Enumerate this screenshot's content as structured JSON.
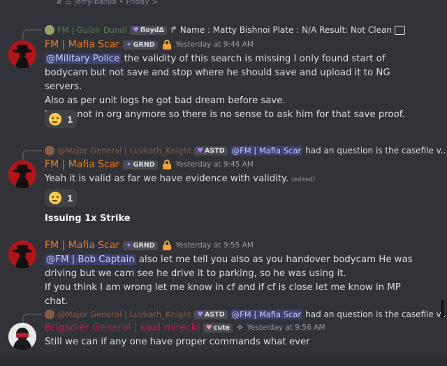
{
  "thread_header": "# ☰ jerry-barba • Friday >",
  "messages": [
    {
      "reply_to": {
        "author": "FM | Gulbir Dundl",
        "author_tag": "floydΔ",
        "text": "Name : Matty Bishnoi Plate : N/A Result: Not Clean"
      },
      "author": "FM | Mafia Scar",
      "tag": "GRND",
      "timestamp": "Yesterday at 9:44 AM",
      "mention": "@Military Police",
      "lines": [
        " the validity of this search is missing I only found start of bodycam but not save and stop where he should save and upload it to NG servers.",
        "Also as per unit logs he got bad dream before save.",
        "Unit is not in org anymore so there is no sense to ask him for that save proof."
      ],
      "reaction": {
        "emoji": "thinking-face",
        "count": "1"
      }
    },
    {
      "reply_to": {
        "author": "@Major General | Luvkath_Knight",
        "author_tag": "ASTD",
        "mention": "@FM | Mafia Scar",
        "text": "had an question is the casefile v..."
      },
      "author": "FM | Mafia Scar",
      "tag": "GRND",
      "timestamp": "Yesterday at 9:45 AM",
      "lines": [
        "Yeah it is valid as far we have evidence with validity."
      ],
      "edited": "(edited)",
      "reaction": {
        "emoji": "thinking-face",
        "count": "1"
      }
    },
    {
      "standalone": "Issuing 1x Strike"
    },
    {
      "author": "FM | Mafia Scar",
      "tag": "GRND",
      "timestamp": "Yesterday at 9:55 AM",
      "mention": "@FM | Bob Captain",
      "lines": [
        " also let me tell you also as you handover bodycam He was driving but we cam see he drive it to parking, so he was using it.",
        "If you think I am wrong let me know in cf and if cf is close let me know in MP chat."
      ]
    },
    {
      "reply_to": {
        "author": "@Major General | Luvkath_Knight",
        "author_tag": "ASTD",
        "mention": "@FM | Mafia Scar",
        "text": "had an question is the casefile v..."
      },
      "author": "Brigadier General | kaal mirecki",
      "tag": "cute",
      "timestamp": "Yesterday at 9:56 AM",
      "lines": [
        "Still we can if any one have proper  commands what ever"
      ]
    }
  ],
  "colors": {
    "background": "#323339",
    "author_orange": "#e67e22",
    "author_pink": "#c2185b",
    "mention_bg": "#4e5494"
  }
}
